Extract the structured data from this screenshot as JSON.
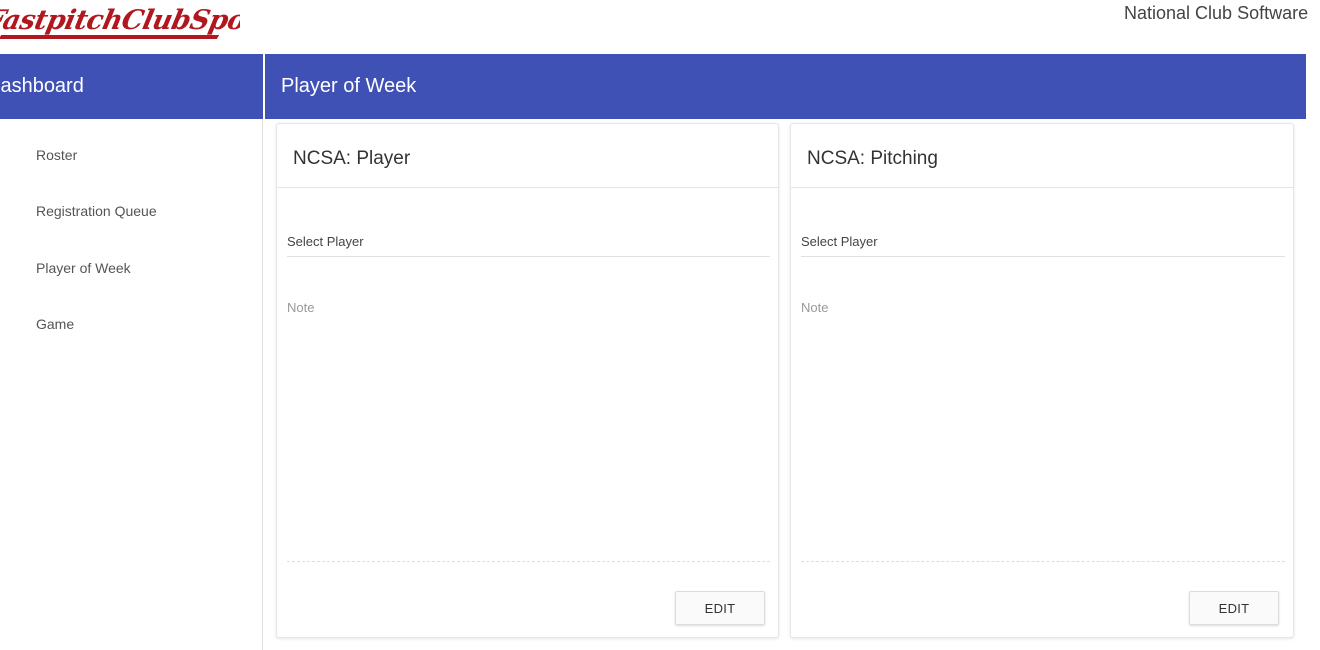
{
  "header": {
    "logo_text": "FastpitchClubSports",
    "company_name": "National Club Software"
  },
  "sidebar": {
    "title": "Dashboard",
    "items": [
      {
        "label": "Roster"
      },
      {
        "label": "Registration Queue"
      },
      {
        "label": "Player of Week"
      },
      {
        "label": "Game"
      }
    ]
  },
  "main": {
    "title": "Player of Week",
    "cards": [
      {
        "title": "NCSA: Player",
        "select_placeholder": "Select Player",
        "note_placeholder": "Note",
        "button_label": "EDIT"
      },
      {
        "title": "NCSA: Pitching",
        "select_placeholder": "Select Player",
        "note_placeholder": "Note",
        "button_label": "EDIT"
      }
    ]
  },
  "colors": {
    "primary": "#3f51b5",
    "logo": "#b0171f"
  }
}
